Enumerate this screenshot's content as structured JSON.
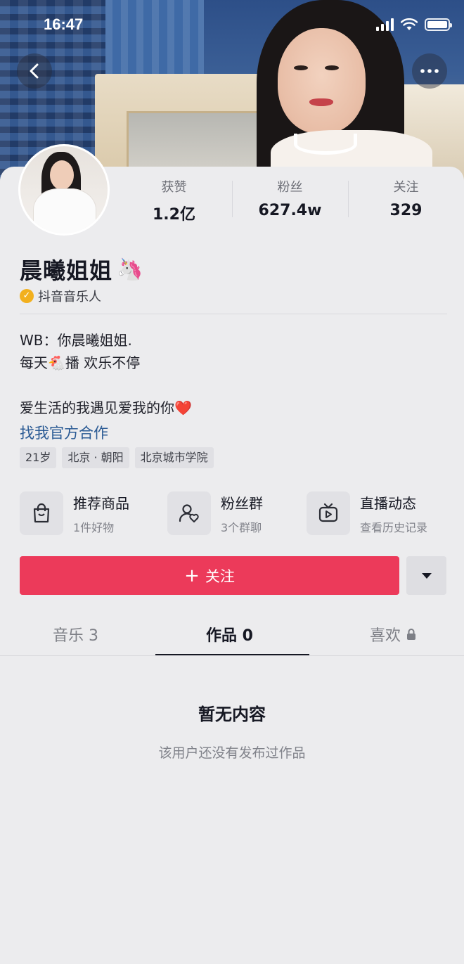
{
  "status_bar": {
    "time": "16:47"
  },
  "profile": {
    "name": "晨曦姐姐",
    "name_emoji": "🦄",
    "verification": "抖音音乐人",
    "verification_badge_icon": "check-badge-icon"
  },
  "stats": [
    {
      "label": "获赞",
      "value": "1.2亿"
    },
    {
      "label": "粉丝",
      "value": "627.4w"
    },
    {
      "label": "关注",
      "value": "329"
    }
  ],
  "bio": {
    "line1": "WB：你晨曦姐姐.",
    "line2": "每天🐔播  欢乐不停",
    "line3": "爱生活的我遇见爱我的你❤️",
    "link": "找我官方合作"
  },
  "tags": [
    "21岁",
    "北京 · 朝阳",
    "北京城市学院"
  ],
  "features": [
    {
      "title": "推荐商品",
      "subtitle": "1件好物",
      "icon": "shopping-bag-icon"
    },
    {
      "title": "粉丝群",
      "subtitle": "3个群聊",
      "icon": "fan-group-icon"
    },
    {
      "title": "直播动态",
      "subtitle": "查看历史记录",
      "icon": "live-tv-icon"
    }
  ],
  "follow_button": {
    "plus": "+",
    "label": "关注"
  },
  "tabs": [
    {
      "label": "音乐 3"
    },
    {
      "label": "作品 0"
    },
    {
      "label": "喜欢"
    }
  ],
  "empty_state": {
    "title": "暂无内容",
    "subtitle": "该用户还没有发布过作品"
  },
  "colors": {
    "accent": "#ec3a5a",
    "link": "#2a5a94",
    "verify": "#f2b01e",
    "background": "#ececee"
  }
}
